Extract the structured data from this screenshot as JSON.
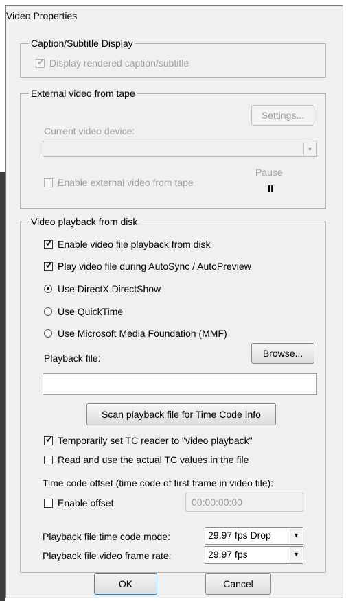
{
  "window": {
    "title": "Video Properties"
  },
  "caption_group": {
    "legend": "Caption/Subtitle Display",
    "display_rendered_label": "Display rendered caption/subtitle",
    "display_rendered_checked": true
  },
  "external_group": {
    "legend": "External video from tape",
    "settings_label": "Settings...",
    "current_device_label": "Current video device:",
    "current_device_value": "",
    "enable_external_label": "Enable external video from tape",
    "enable_external_checked": false,
    "pause_label": "Pause",
    "pause_glyph": "II"
  },
  "disk_group": {
    "legend": "Video playback from disk",
    "enable_playback_label": "Enable video file playback from disk",
    "enable_playback_checked": true,
    "play_during_label": "Play video file during AutoSync / AutoPreview",
    "play_during_checked": true,
    "radio_directshow_label": "Use DirectX DirectShow",
    "radio_quicktime_label": "Use QuickTime",
    "radio_mmf_label": "Use Microsoft Media Foundation (MMF)",
    "selected_engine": "Use DirectX DirectShow",
    "playback_file_label": "Playback file:",
    "browse_label": "Browse...",
    "playback_file_value": "",
    "scan_label": "Scan playback file for Time Code Info",
    "temp_tc_label": "Temporarily set TC reader to \"video playback\"",
    "temp_tc_checked": true,
    "read_actual_label": "Read and use the actual TC values in the file",
    "read_actual_checked": false,
    "offset_heading": "Time code offset (time code of first frame in video file):",
    "enable_offset_label": "Enable offset",
    "enable_offset_checked": false,
    "offset_value": "00:00:00:00",
    "tc_mode_label": "Playback file time code mode:",
    "tc_mode_value": "29.97 fps Drop",
    "frame_rate_label": "Playback file video frame rate:",
    "frame_rate_value": "29.97 fps"
  },
  "footer": {
    "ok_label": "OK",
    "cancel_label": "Cancel"
  },
  "icons": {
    "check": "✔",
    "dropdown": "▼"
  }
}
